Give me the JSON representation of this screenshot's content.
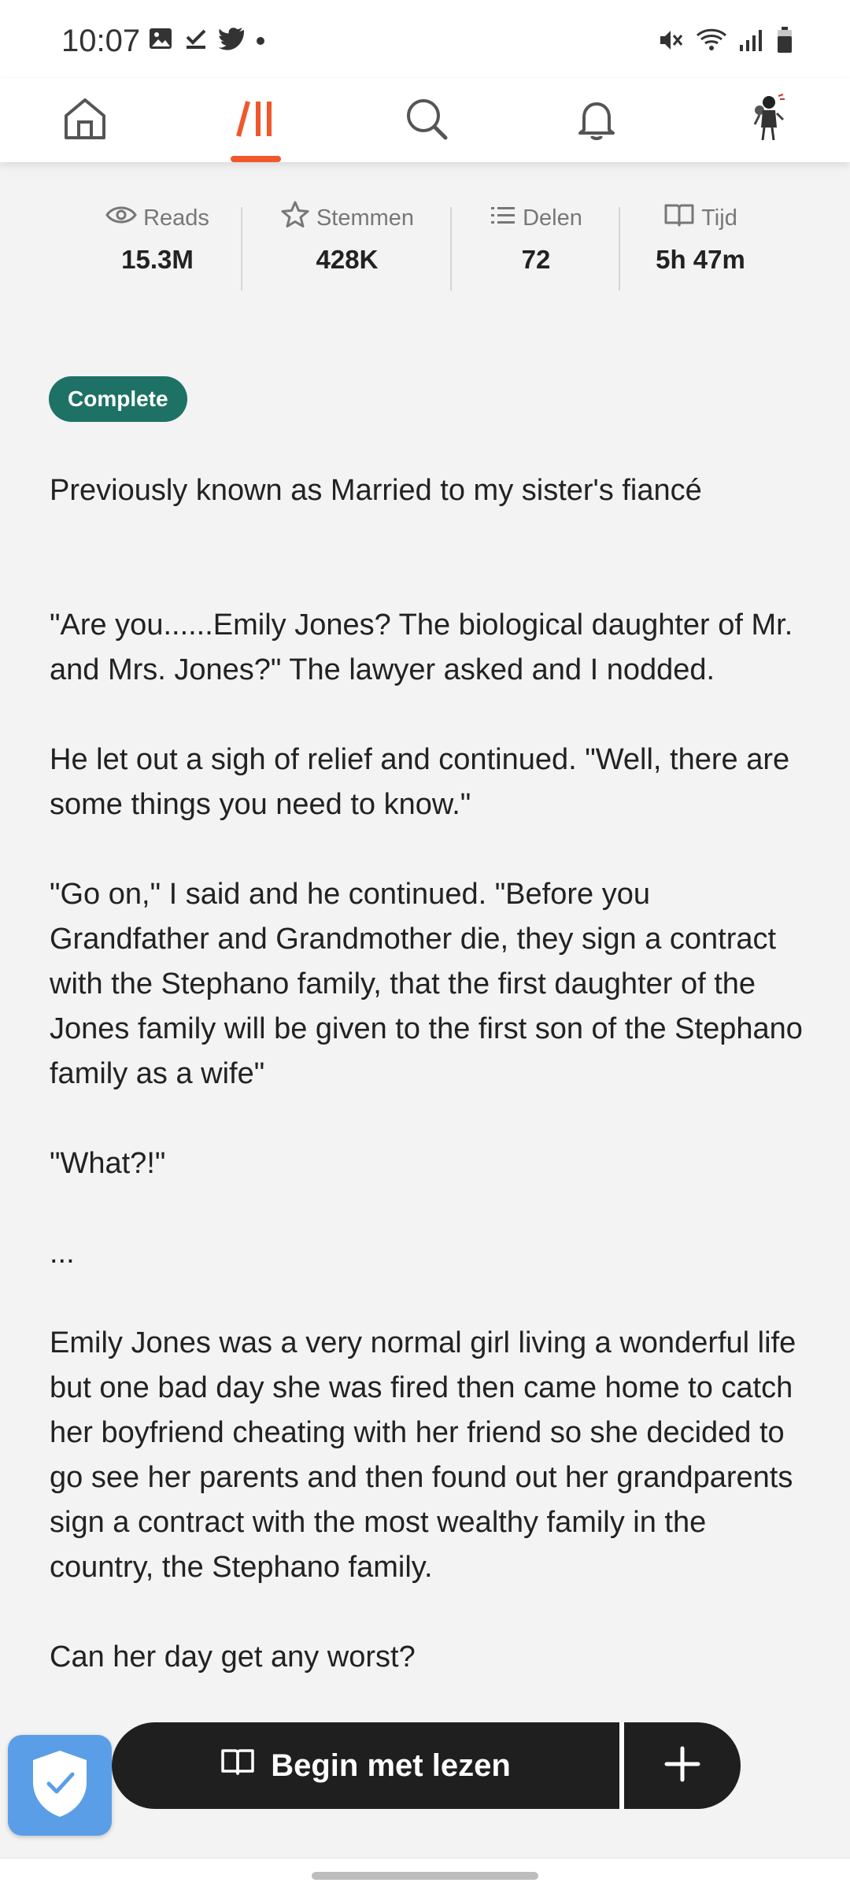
{
  "status_bar": {
    "time": "10:07",
    "left_icons": [
      "image-icon",
      "check-icon",
      "twitter-icon",
      "dot-icon"
    ],
    "right_icons": [
      "mute-icon",
      "wifi-icon",
      "signal-icon",
      "battery-icon"
    ]
  },
  "top_nav": {
    "items": [
      "home-icon",
      "library-icon",
      "search-icon",
      "bell-icon",
      "avatar"
    ],
    "active": "library-icon",
    "accent_color": "#f0572a"
  },
  "stats": [
    {
      "label": "Reads",
      "value": "15.3M",
      "icon": "eye-icon"
    },
    {
      "label": "Stemmen",
      "value": "428K",
      "icon": "star-icon"
    },
    {
      "label": "Delen",
      "value": "72",
      "icon": "list-icon"
    },
    {
      "label": "Tijd",
      "value": "5h 47m",
      "icon": "book-open-icon"
    }
  ],
  "badge": {
    "label": "Complete",
    "color": "#1e7265"
  },
  "description": {
    "p1": "Previously known as Married to my sister's fiancé",
    "p2": "\"Are you......Emily Jones? The biological daughter of Mr. and Mrs. Jones?\" The lawyer asked and I nodded.",
    "p3": "He let out a sigh of relief and continued. \"Well, there are some things you need to know.\"",
    "p4": "\"Go on,\" I said and he continued. \"Before you Grandfather and Grandmother die, they sign a contract with the Stephano family, that the first daughter of the Jones family will be given to the first son of the Stephano family as a wife\"",
    "p5": "\"What?!\"",
    "p6": "...",
    "p7": "Emily Jones was a very normal girl living a wonderful life but one bad day she was fired then came home to catch her boyfriend cheating with her friend so she decided to go see her parents and then found out her grandparents sign a contract with the most wealthy family in the country, the Stephano family.",
    "p8": "Can her day get any worst?"
  },
  "actions": {
    "read_label": "Begin met lezen",
    "add_icon": "plus-icon"
  }
}
